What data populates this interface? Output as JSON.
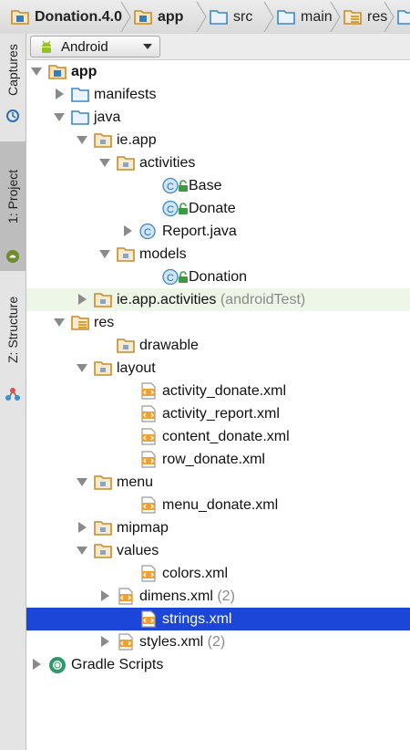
{
  "breadcrumb": [
    {
      "label": "Donation.4.0",
      "icon": "project-folder-icon",
      "bold": true
    },
    {
      "label": "app",
      "icon": "module-folder-icon",
      "bold": true
    },
    {
      "label": "src",
      "icon": "folder-icon"
    },
    {
      "label": "main",
      "icon": "folder-icon"
    },
    {
      "label": "res",
      "icon": "resource-folder-icon"
    },
    {
      "label": "",
      "icon": "folder-icon"
    }
  ],
  "tool_tabs": {
    "captures": "Captures",
    "project": "1: Project",
    "structure": "Z: Structure"
  },
  "toolbar": {
    "view_select": "Android"
  },
  "tree": [
    {
      "label": "app",
      "bold": true,
      "icon": "module-folder-icon",
      "depth": 0,
      "arrow": "down"
    },
    {
      "label": "manifests",
      "icon": "folder-icon",
      "depth": 1,
      "arrow": "right"
    },
    {
      "label": "java",
      "icon": "folder-icon",
      "depth": 1,
      "arrow": "down"
    },
    {
      "label": "ie.app",
      "icon": "package-icon",
      "depth": 2,
      "arrow": "down"
    },
    {
      "label": "activities",
      "icon": "package-icon",
      "depth": 3,
      "arrow": "down"
    },
    {
      "label": "Base",
      "icon": "class-icon",
      "lock": true,
      "depth": 5,
      "arrow": ""
    },
    {
      "label": "Donate",
      "icon": "class-icon",
      "lock": true,
      "depth": 5,
      "arrow": ""
    },
    {
      "label": "Report.java",
      "icon": "class-icon",
      "depth": 4,
      "arrow": "right"
    },
    {
      "label": "models",
      "icon": "package-icon",
      "depth": 3,
      "arrow": "down"
    },
    {
      "label": "Donation",
      "icon": "class-icon",
      "lock": true,
      "depth": 5,
      "arrow": ""
    },
    {
      "label": "ie.app.activities",
      "suffix": "(androidTest)",
      "icon": "package-icon",
      "depth": 2,
      "arrow": "right",
      "tint": true
    },
    {
      "label": "res",
      "icon": "resource-folder-icon",
      "depth": 1,
      "arrow": "down"
    },
    {
      "label": "drawable",
      "icon": "package-icon",
      "depth": 3,
      "arrow": ""
    },
    {
      "label": "layout",
      "icon": "package-icon",
      "depth": 2,
      "arrow": "down"
    },
    {
      "label": "activity_donate.xml",
      "icon": "xml-file-icon",
      "depth": 4,
      "arrow": ""
    },
    {
      "label": "activity_report.xml",
      "icon": "xml-file-icon",
      "depth": 4,
      "arrow": ""
    },
    {
      "label": "content_donate.xml",
      "icon": "xml-file-icon",
      "depth": 4,
      "arrow": ""
    },
    {
      "label": "row_donate.xml",
      "icon": "xml-file-icon",
      "depth": 4,
      "arrow": ""
    },
    {
      "label": "menu",
      "icon": "package-icon",
      "depth": 2,
      "arrow": "down"
    },
    {
      "label": "menu_donate.xml",
      "icon": "xml-file-icon",
      "depth": 4,
      "arrow": ""
    },
    {
      "label": "mipmap",
      "icon": "package-icon",
      "depth": 2,
      "arrow": "right"
    },
    {
      "label": "values",
      "icon": "package-icon",
      "depth": 2,
      "arrow": "down"
    },
    {
      "label": "colors.xml",
      "icon": "xml-file-icon",
      "depth": 4,
      "arrow": ""
    },
    {
      "label": "dimens.xml",
      "suffix": "(2)",
      "icon": "xml-file-icon",
      "depth": 3,
      "arrow": "right"
    },
    {
      "label": "strings.xml",
      "icon": "xml-file-icon",
      "depth": 4,
      "arrow": "",
      "selected": true
    },
    {
      "label": "styles.xml",
      "suffix": "(2)",
      "icon": "xml-file-icon",
      "depth": 3,
      "arrow": "right"
    },
    {
      "label": "Gradle Scripts",
      "icon": "gradle-icon",
      "depth": 0,
      "arrow": "right"
    }
  ],
  "colors": {
    "selection": "#1c46d8",
    "folder": "#c98a2b",
    "module": "#2f7fc1",
    "android": "#97c024"
  }
}
